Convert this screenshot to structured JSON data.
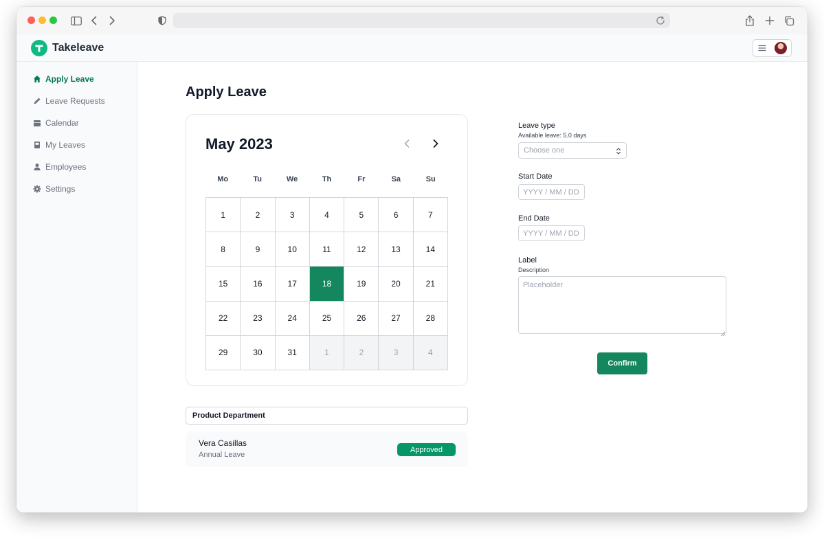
{
  "app": {
    "brand": "Takeleave"
  },
  "sidebar": {
    "items": [
      {
        "label": "Apply Leave",
        "icon": "home-icon",
        "active": true
      },
      {
        "label": "Leave Requests",
        "icon": "pencil-icon",
        "active": false
      },
      {
        "label": "Calendar",
        "icon": "calendar-icon",
        "active": false
      },
      {
        "label": "My Leaves",
        "icon": "book-icon",
        "active": false
      },
      {
        "label": "Employees",
        "icon": "user-icon",
        "active": false
      },
      {
        "label": "Settings",
        "icon": "gear-icon",
        "active": false
      }
    ]
  },
  "page": {
    "title": "Apply Leave"
  },
  "calendar": {
    "month_label": "May 2023",
    "weekdays": [
      "Mo",
      "Tu",
      "We",
      "Th",
      "Fr",
      "Sa",
      "Su"
    ],
    "days": [
      "1",
      "2",
      "3",
      "4",
      "5",
      "6",
      "7",
      "8",
      "9",
      "10",
      "11",
      "12",
      "13",
      "14",
      "15",
      "16",
      "17",
      "18",
      "19",
      "20",
      "21",
      "22",
      "23",
      "24",
      "25",
      "26",
      "27",
      "28",
      "29",
      "30",
      "31",
      "1",
      "2",
      "3",
      "4"
    ],
    "selected_day": "18",
    "trailing_next_month_days": 4
  },
  "department": {
    "name": "Product Department"
  },
  "requests": [
    {
      "name": "Vera Casillas",
      "type": "Annual Leave",
      "status": "Approved"
    }
  ],
  "form": {
    "leave_type_label": "Leave type",
    "available_leave": "Available leave: 5.0 days",
    "leave_type_placeholder": "Choose one",
    "start_date_label": "Start Date",
    "start_date_placeholder": "YYYY / MM / DD",
    "end_date_label": "End Date",
    "end_date_placeholder": "YYYY / MM / DD",
    "label_label": "Label",
    "label_description": "Description",
    "label_placeholder": "Placeholder",
    "confirm_label": "Confirm"
  },
  "colors": {
    "brand": "#10b981",
    "primary": "#15875f",
    "approved": "#059669"
  }
}
